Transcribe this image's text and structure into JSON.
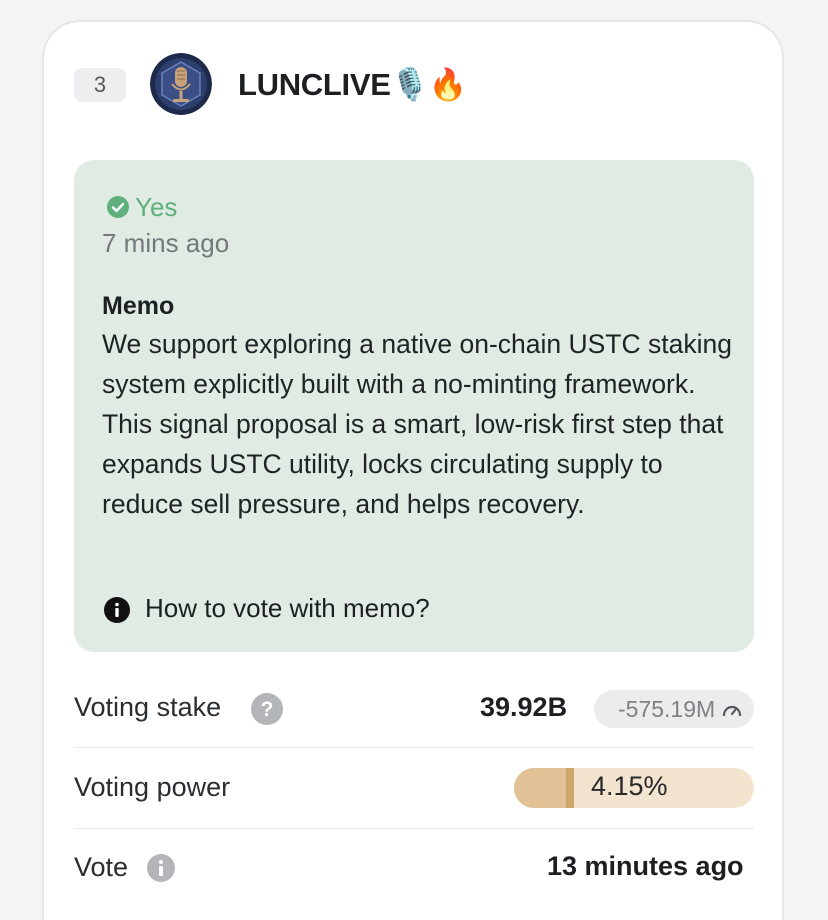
{
  "validator": {
    "rank": "3",
    "name": "LUNCLIVE🎙️🔥",
    "vote": {
      "option": "Yes",
      "time": "7 mins ago",
      "memo_heading": "Memo",
      "memo_text": "We support exploring a native on-chain USTC staking system explicitly built with a no-minting framework. This signal proposal is a smart, low-risk first step that expands USTC utility, locks circulating supply to reduce sell pressure, and helps recovery.",
      "help_link": "How to vote with memo?"
    },
    "stats": {
      "voting_stake_label": "Voting stake",
      "voting_stake_value": "39.92B",
      "voting_stake_change": "-575.19M",
      "voting_power_label": "Voting power",
      "voting_power_value": "4.15%",
      "voting_power_fraction": 0.25,
      "vote_label": "Vote",
      "vote_time": "13 minutes ago"
    }
  },
  "colors": {
    "panel_green": "#dfebe3",
    "yes_green": "#5fb07c",
    "power_fill": "#e3c196",
    "power_track": "#f3e4cf"
  },
  "icons": [
    "avatar-microphone",
    "check-circle-icon",
    "info-icon",
    "question-icon",
    "gauge-icon"
  ]
}
